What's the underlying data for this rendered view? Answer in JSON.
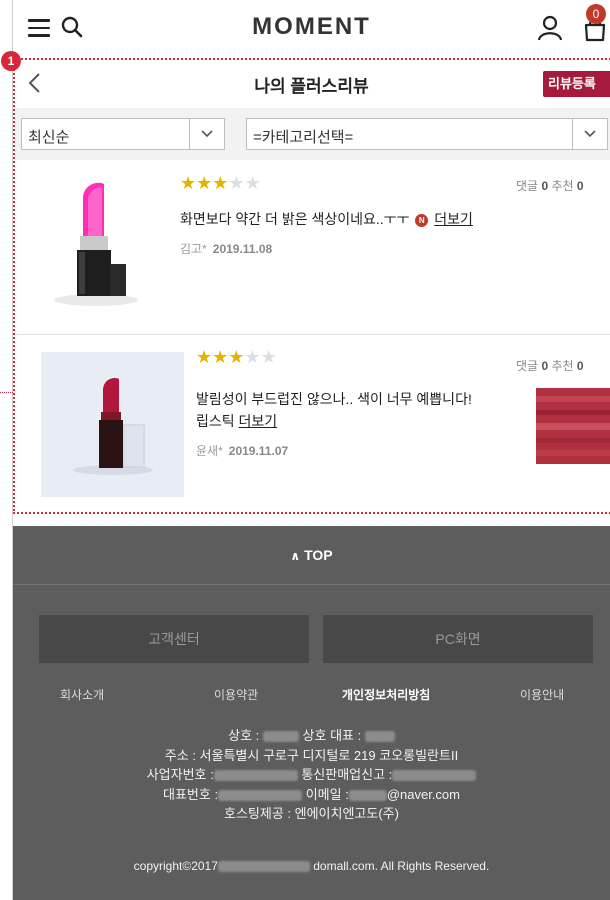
{
  "header": {
    "logo": "MOMENT",
    "cart_count": "0"
  },
  "annotation": {
    "marker": "1"
  },
  "page": {
    "title": "나의 플러스리뷰",
    "write_button": "리뷰등록"
  },
  "filters": {
    "sort_selected": "최신순",
    "category_selected": "=카테고리선택="
  },
  "reviews": [
    {
      "rating": 3,
      "max_rating": 5,
      "comments_label": "댓글",
      "comments_count": "0",
      "recommend_label": "추천",
      "recommend_count": "0",
      "text": "화면보다 약간 더 밝은 색상이네요..ㅜㅜ",
      "badge": "N",
      "more": "더보기",
      "author": "김고*",
      "date": "2019.11.08"
    },
    {
      "rating": 3,
      "max_rating": 5,
      "comments_label": "댓글",
      "comments_count": "0",
      "recommend_label": "추천",
      "recommend_count": "0",
      "text_line1": "발림성이 부드럽진 않으나.. 색이 너무 예쁩니다!",
      "text_line2": "립스틱",
      "more": "더보기",
      "author": "윤새*",
      "date": "2019.11.07"
    }
  ],
  "footer": {
    "top_label": "TOP",
    "customer_center": "고객센터",
    "pc_view": "PC화면",
    "links": [
      "회사소개",
      "이용약관",
      "개인정보처리방침",
      "이용안내"
    ],
    "company": {
      "name_label": "상호 :",
      "ceo_label": "상호 대표 :",
      "address": "주소 : 서울특별시 구로구 디지털로 219 코오롱빌란트II",
      "biz_no_label": "사업자번호 :",
      "mail_order_label": "통신판매업신고 :",
      "phone_label": "대표번호 :",
      "email_label": "이메일 :",
      "email_domain": "@naver.com",
      "hosting": "호스팅제공 : 엔에이치엔고도(주)"
    },
    "copyright_prefix": "copyright©2017",
    "copyright_suffix": "domall.com. All Rights Reserved."
  },
  "colors": {
    "accent": "#a61b3b",
    "annotation": "#d6283a",
    "star": "#e2b400",
    "footer_bg": "#5d5d5d"
  }
}
